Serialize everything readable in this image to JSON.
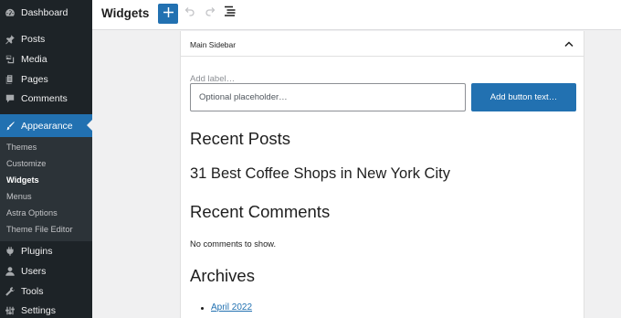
{
  "sidebar": {
    "items": [
      {
        "label": "Dashboard",
        "icon": "dashboard-icon"
      },
      {
        "label": "Posts",
        "icon": "pin-icon"
      },
      {
        "label": "Media",
        "icon": "media-icon"
      },
      {
        "label": "Pages",
        "icon": "pages-icon"
      },
      {
        "label": "Comments",
        "icon": "comments-icon"
      },
      {
        "label": "Appearance",
        "icon": "brush-icon",
        "active": true
      },
      {
        "label": "Plugins",
        "icon": "plugin-icon"
      },
      {
        "label": "Users",
        "icon": "users-icon"
      },
      {
        "label": "Tools",
        "icon": "wrench-icon"
      },
      {
        "label": "Settings",
        "icon": "settings-icon"
      }
    ],
    "submenu": [
      "Themes",
      "Customize",
      "Widgets",
      "Menus",
      "Astra Options",
      "Theme File Editor"
    ],
    "submenu_current": "Widgets"
  },
  "toolbar": {
    "title": "Widgets",
    "add_icon": "plus-icon",
    "undo_icon": "undo-icon",
    "redo_icon": "redo-icon",
    "list_view_icon": "list-view-icon"
  },
  "panel": {
    "title": "Main Sidebar",
    "toggle_icon": "chevron-up-icon",
    "search": {
      "label": "Add label…",
      "placeholder": "Optional placeholder…",
      "button": "Add button text…"
    },
    "recent_posts": {
      "heading": "Recent Posts",
      "items": [
        "31 Best Coffee Shops in New York City"
      ]
    },
    "recent_comments": {
      "heading": "Recent Comments",
      "empty": "No comments to show."
    },
    "archives": {
      "heading": "Archives",
      "items": [
        "April 2022"
      ]
    }
  },
  "colors": {
    "sidebar_bg": "#1d2327",
    "submenu_bg": "#2c3338",
    "accent": "#2271b1",
    "canvas_bg": "#f0f0f1"
  }
}
